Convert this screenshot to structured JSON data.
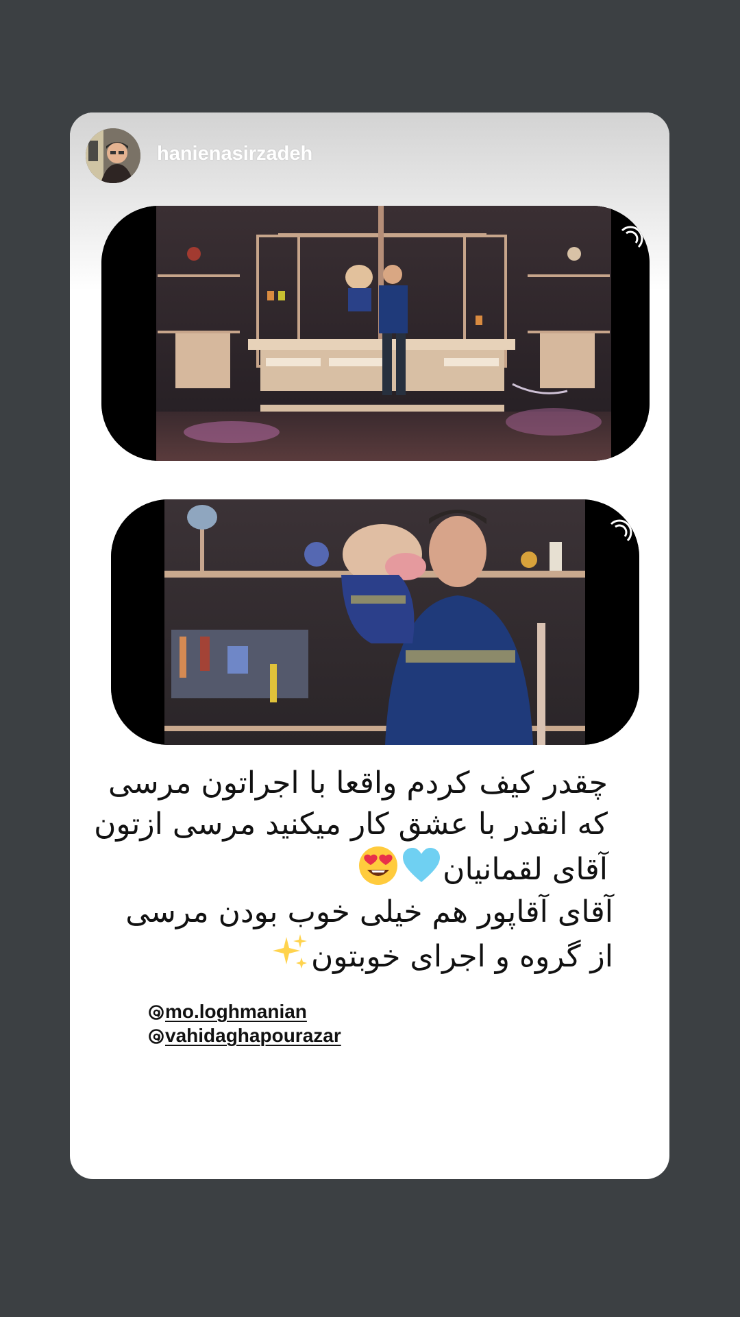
{
  "story": {
    "username": "hanienasirzadeh",
    "caption_1": {
      "lines": [
        "چقدر کیف کردم واقعا با اجراتون مرسی",
        "که انقدر با عشق کار میکنید مرسی ازتون",
        "آقای لقمانیان"
      ],
      "emojis": [
        "light-blue-heart",
        "heart-eyes"
      ]
    },
    "caption_2": {
      "lines": [
        "آقای آقاپور هم خیلی خوب بودن مرسی",
        "از گروه و اجرای خوبتون"
      ],
      "emojis": [
        "sparkles"
      ]
    },
    "mentions": [
      "mo.loghmanian",
      "vahidaghapourazar"
    ],
    "photos": [
      {
        "name": "stage-wide-shot"
      },
      {
        "name": "stage-closeup-shot"
      }
    ]
  },
  "colors": {
    "page_background": "#3c4043",
    "card_background": "#ffffff",
    "sweater_blue": "#1f3a7a",
    "stage_wood": "#d9c2a8"
  }
}
